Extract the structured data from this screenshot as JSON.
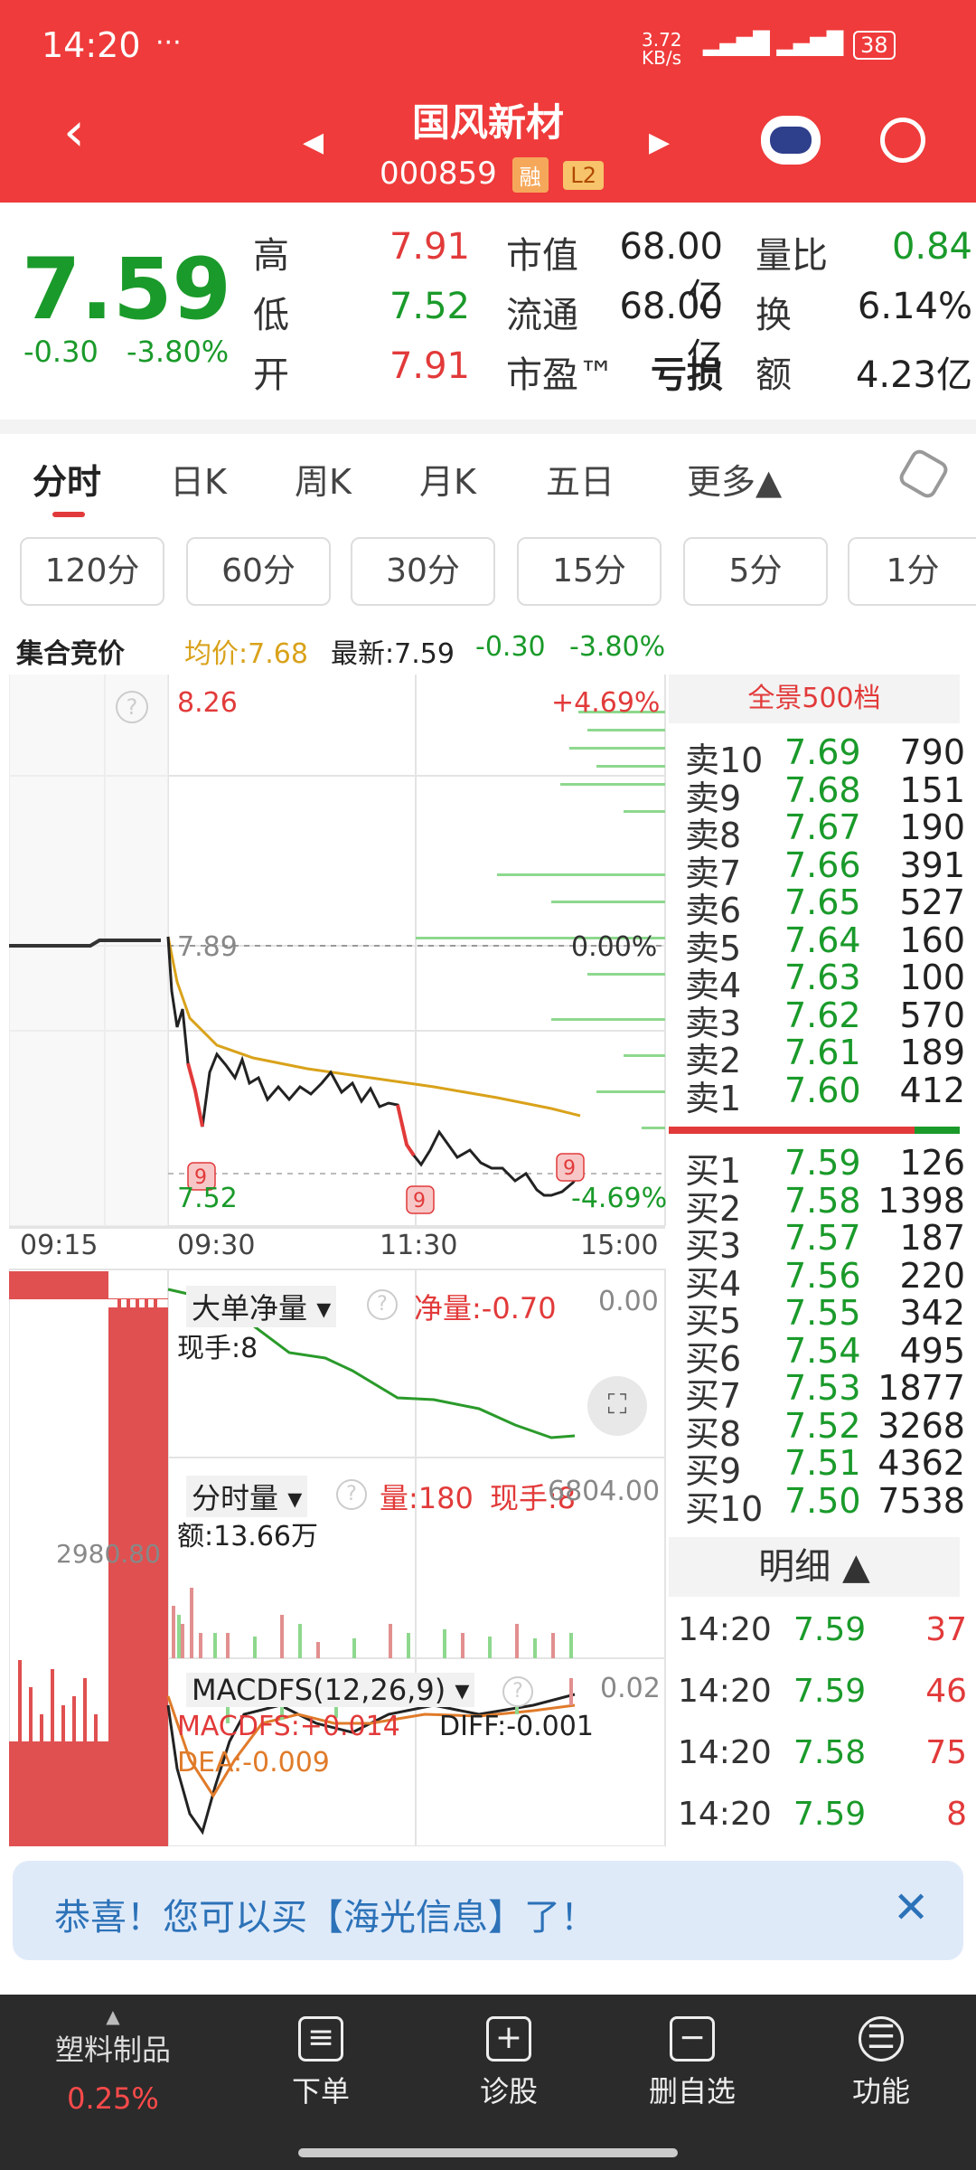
{
  "status_bar": {
    "time": "14:20",
    "speed": "3.72 KB/s",
    "battery": "38"
  },
  "header": {
    "title": "国风新材",
    "code": "000859",
    "tag1": "融",
    "tag2": "L2"
  },
  "quote": {
    "price": "7.59",
    "change": "-0.30",
    "change_pct": "-3.80%",
    "high_label": "高",
    "high": "7.91",
    "low_label": "低",
    "low": "7.52",
    "open_label": "开",
    "open": "7.91",
    "mktcap_label": "市值",
    "mktcap": "68.00亿",
    "float_label": "流通",
    "float": "68.00亿",
    "pe_label": "市盈™",
    "pe": "亏损",
    "vr_label": "量比",
    "vr": "0.84",
    "turn_label": "换",
    "turn": "6.14%",
    "amt_label": "额",
    "amt": "4.23亿"
  },
  "tabs": [
    "分时",
    "日K",
    "周K",
    "月K",
    "五日",
    "更多▲"
  ],
  "periods": [
    "120分",
    "60分",
    "30分",
    "15分",
    "5分",
    "1分"
  ],
  "info": {
    "auction": "集合竞价",
    "avg": "均价:7.68",
    "latest": "最新:7.59",
    "chg": "-0.30",
    "pct": "-3.80%"
  },
  "chart": {
    "top_price": "8.26",
    "top_pct": "+4.69%",
    "mid_price": "7.89",
    "mid_pct": "0.00%",
    "low_price": "7.52",
    "low_pct": "-4.69%",
    "times": [
      "09:15",
      "09:30",
      "11:30",
      "15:00"
    ],
    "marker": "9",
    "auction_value": "2980.80",
    "netvol_label": "大单净量",
    "netvol_val": "净量:-0.70",
    "netvol_top": "0.00",
    "netvol_hand": "现手:8",
    "vol_label": "分时量",
    "vol_val": "量:180",
    "vol_hand": "现手:8",
    "vol_top": "6804.00",
    "vol_amt": "额:13.66万",
    "macd_label": "MACDFS(12,26,9)",
    "macd_top": "0.02",
    "macd_val": "MACDFS:+0.014",
    "diff_val": "DIFF:-0.001",
    "dea_val": "DEA:-0.009"
  },
  "orderbook": {
    "title": "全景500档",
    "asks": [
      {
        "l": "卖10",
        "p": "7.69",
        "v": "790"
      },
      {
        "l": "卖9",
        "p": "7.68",
        "v": "151"
      },
      {
        "l": "卖8",
        "p": "7.67",
        "v": "190"
      },
      {
        "l": "卖7",
        "p": "7.66",
        "v": "391"
      },
      {
        "l": "卖6",
        "p": "7.65",
        "v": "527"
      },
      {
        "l": "卖5",
        "p": "7.64",
        "v": "160"
      },
      {
        "l": "卖4",
        "p": "7.63",
        "v": "100"
      },
      {
        "l": "卖3",
        "p": "7.62",
        "v": "570"
      },
      {
        "l": "卖2",
        "p": "7.61",
        "v": "189"
      },
      {
        "l": "卖1",
        "p": "7.60",
        "v": "412"
      }
    ],
    "bids": [
      {
        "l": "买1",
        "p": "7.59",
        "v": "126"
      },
      {
        "l": "买2",
        "p": "7.58",
        "v": "1398"
      },
      {
        "l": "买3",
        "p": "7.57",
        "v": "187"
      },
      {
        "l": "买4",
        "p": "7.56",
        "v": "220"
      },
      {
        "l": "买5",
        "p": "7.55",
        "v": "342"
      },
      {
        "l": "买6",
        "p": "7.54",
        "v": "495"
      },
      {
        "l": "买7",
        "p": "7.53",
        "v": "1877"
      },
      {
        "l": "买8",
        "p": "7.52",
        "v": "3268"
      },
      {
        "l": "买9",
        "p": "7.51",
        "v": "4362"
      },
      {
        "l": "买10",
        "p": "7.50",
        "v": "7538"
      }
    ],
    "detail_title": "明细 ▲",
    "detail": [
      {
        "t": "14:20",
        "p": "7.59",
        "v": "37"
      },
      {
        "t": "14:20",
        "p": "7.59",
        "v": "46"
      },
      {
        "t": "14:20",
        "p": "7.58",
        "v": "75"
      },
      {
        "t": "14:20",
        "p": "7.59",
        "v": "8"
      }
    ]
  },
  "banner": {
    "text": "恭喜！您可以买【海光信息】了！"
  },
  "bottom": {
    "sector": "塑料制品",
    "sector_pct": "0.25%",
    "order": "下单",
    "diag": "诊股",
    "del": "删自选",
    "func": "功能"
  },
  "colors": {
    "header_red": "#ef3b3b",
    "up": "#e23a3a",
    "down": "#1a9a2a",
    "avg_line": "#d9a21a"
  }
}
